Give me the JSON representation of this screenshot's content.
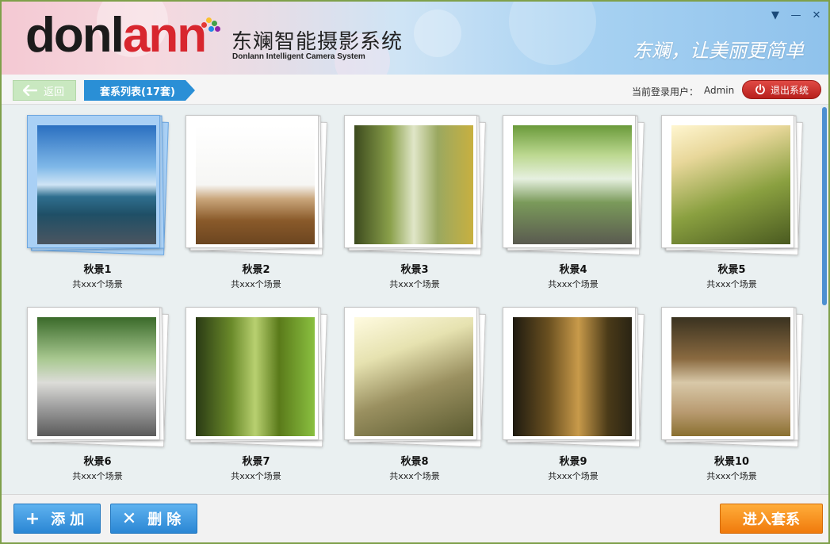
{
  "header": {
    "logo_text_dark": "donl",
    "logo_text_red": "ann",
    "brand_cn": "东斓智能摄影系统",
    "brand_en": "Donlann Intelligent Camera System",
    "slogan": "东斓，让美丽更简单",
    "window_controls": [
      "▼",
      "—",
      "✕"
    ]
  },
  "toolbar": {
    "back_label": "返回",
    "breadcrumb": "套系列表(17套)",
    "user_label": "当前登录用户：",
    "user_name": "Admin",
    "logout_label": "退出系统"
  },
  "cards": [
    {
      "title": "秋景1",
      "subtitle": "共xxx个场景",
      "selected": true
    },
    {
      "title": "秋景2",
      "subtitle": "共xxx个场景",
      "selected": false
    },
    {
      "title": "秋景3",
      "subtitle": "共xxx个场景",
      "selected": false
    },
    {
      "title": "秋景4",
      "subtitle": "共xxx个场景",
      "selected": false
    },
    {
      "title": "秋景5",
      "subtitle": "共xxx个场景",
      "selected": false
    },
    {
      "title": "秋景6",
      "subtitle": "共xxx个场景",
      "selected": false
    },
    {
      "title": "秋景7",
      "subtitle": "共xxx个场景",
      "selected": false
    },
    {
      "title": "秋景8",
      "subtitle": "共xxx个场景",
      "selected": false
    },
    {
      "title": "秋景9",
      "subtitle": "共xxx个场景",
      "selected": false
    },
    {
      "title": "秋景10",
      "subtitle": "共xxx个场景",
      "selected": false
    }
  ],
  "footer": {
    "add_label": "添加",
    "add_icon": "+",
    "delete_label": "删除",
    "delete_icon": "✕",
    "enter_label": "进入套系"
  },
  "colors": {
    "accent_blue": "#2a8fd6",
    "logout_red": "#c8302b",
    "enter_orange": "#f58a1f",
    "logo_red": "#d8262e"
  }
}
